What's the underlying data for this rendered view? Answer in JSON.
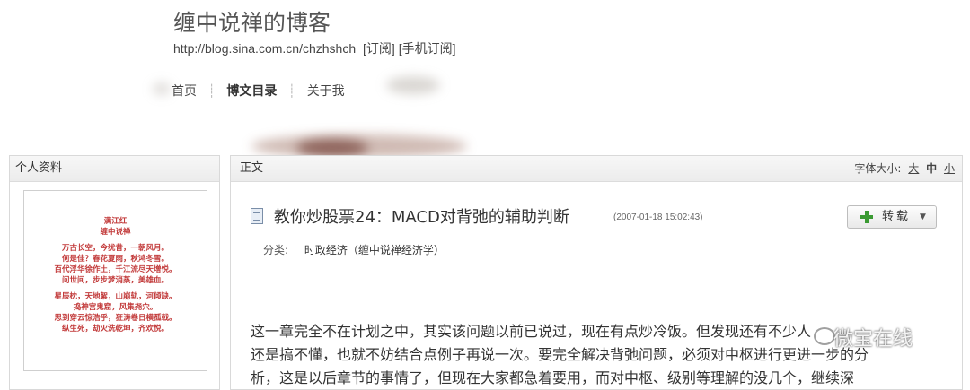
{
  "blog": {
    "title": "缠中说禅的博客",
    "url": "http://blog.sina.com.cn/chzhshch",
    "subscribe": "[订阅]",
    "mobile_subscribe": "[手机订阅]"
  },
  "nav": {
    "items": [
      {
        "label": "首页",
        "active": false
      },
      {
        "label": "博文目录",
        "active": true
      },
      {
        "label": "关于我",
        "active": false
      }
    ]
  },
  "sidebar": {
    "heading": "个人资料",
    "poem_lines": [
      "满江红",
      "缠中说禅",
      "",
      "万古长空，今犹昔，一朝风月。",
      "何是佳？春花夏雨，秋鸿冬雪。",
      "百代浮华徐作土，千江流尽天增悦。",
      "问世间，步步梦消蒸，美雄血。",
      "",
      "星辰枕，天地絮，山崩轨，河倾缺。",
      "捣神宫鬼窟，风集尧穴。",
      "思到穿云惊浩乎，狂涛卷日横孤戟。",
      "纵生死，劫火洗乾坤，齐欢悦。"
    ]
  },
  "main": {
    "heading": "正文",
    "font_size_label": "字体大小:",
    "font_sizes": [
      "大",
      "中",
      "小"
    ],
    "article": {
      "title": "教你炒股票24：MACD对背弛的辅助判断",
      "time": "(2007-01-18 15:02:43)",
      "repost_label": "转载",
      "caret": "▼",
      "category_label": "分类:",
      "category": "时政经济（缠中说禅经济学）",
      "body_lines": [
        "这一章完全不在计划之中，其实该问题以前已说过，现在有点炒冷饭。但发现还有不少人",
        "还是搞不懂，也就不妨结合点例子再说一次。要完全解决背弛问题，必须对中枢进行更进一步的分",
        "析，这是以后章节的事情了，但现在大家都急着要用，而对中枢、级别等理解的没几个，继续深"
      ]
    }
  },
  "watermark": {
    "text": "微宝在线"
  }
}
